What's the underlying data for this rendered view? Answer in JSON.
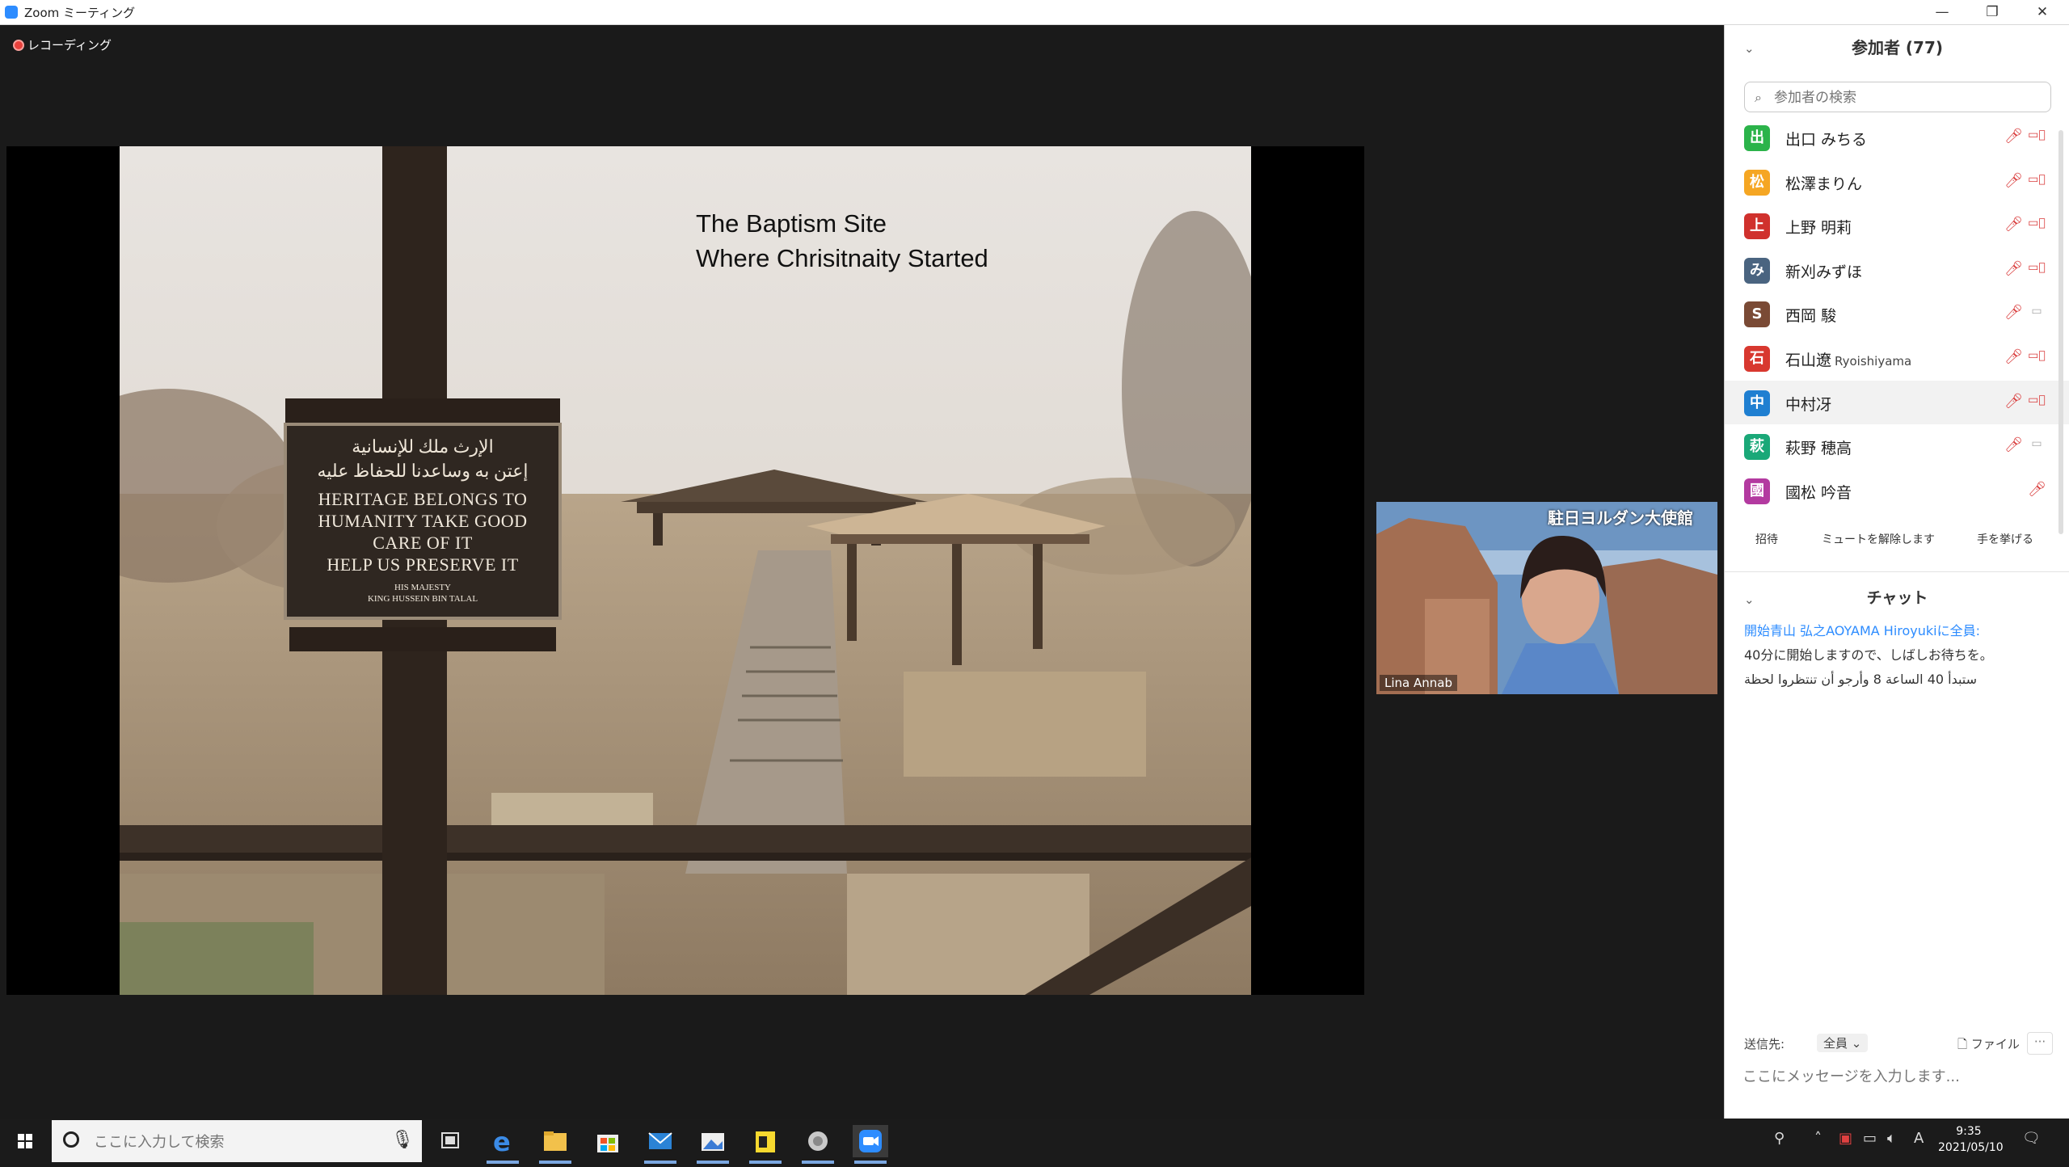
{
  "window": {
    "title": "Zoom ミーティング"
  },
  "meeting": {
    "recording_label": "レコーディング",
    "slide": {
      "title": "The Baptism Site\nWhere Chrisitnaity Started",
      "sign_arabic": "الإرث ملك للإنسانية\nإعتن به وساعدنا للحفاظ عليه",
      "sign_english": "HERITAGE BELONGS TO\nHUMANITY TAKE GOOD\nCARE OF IT\nHELP US PRESERVE IT",
      "sign_sub": "HIS MAJESTY\nKING HUSSEIN BIN TALAL"
    },
    "video": {
      "banner": "駐日ヨルダン大使館",
      "name": "Lina Annab"
    }
  },
  "participants_panel": {
    "title": "参加者 (77)",
    "search_placeholder": "参加者の検索",
    "items": [
      {
        "initial": "出",
        "name": "出口 みちる",
        "sub": "",
        "color": "#2bb34a",
        "mic_muted": true,
        "video_off": true
      },
      {
        "initial": "松",
        "name": "松澤まりん",
        "sub": "",
        "color": "#f5a623",
        "mic_muted": true,
        "video_off": true
      },
      {
        "initial": "上",
        "name": "上野 明莉",
        "sub": "",
        "color": "#d0312d",
        "mic_muted": true,
        "video_off": true
      },
      {
        "initial": "み",
        "name": "新刈みずほ",
        "sub": "",
        "color": "#4a6480",
        "mic_muted": true,
        "video_off": true
      },
      {
        "initial": "S",
        "name": "西岡 駿",
        "sub": "",
        "color": "#7a4a35",
        "mic_muted": true,
        "video_off": false
      },
      {
        "initial": "石",
        "name": "石山遼",
        "sub": "Ryoishiyama",
        "color": "#d8382f",
        "mic_muted": true,
        "video_off": true
      },
      {
        "initial": "中",
        "name": "中村冴",
        "sub": "",
        "color": "#1f7fd1",
        "mic_muted": true,
        "video_off": true
      },
      {
        "initial": "萩",
        "name": "萩野 穂高",
        "sub": "",
        "color": "#1aa878",
        "mic_muted": true,
        "video_off": false
      },
      {
        "initial": "國",
        "name": "國松 吟音",
        "sub": "",
        "color": "#b33aa0",
        "mic_muted": true,
        "video_off": null
      }
    ],
    "buttons": {
      "invite": "招待",
      "unmute_all": "ミュートを解除します",
      "raise_hand": "手を挙げる"
    }
  },
  "chat": {
    "title": "チャット",
    "messages": [
      {
        "from": "開始青山 弘之AOYAMA Hiroyukiに全員:",
        "text": "40分に開始しますので、しばしお待ちを。",
        "text2": "ستبدأ 40 الساعة 8 وأرجو أن تنتظروا لحظة"
      }
    ],
    "send_to_label": "送信先:",
    "send_to_value": "全員",
    "file_label": "ファイル",
    "more_label": "···",
    "input_placeholder": "ここにメッセージを入力します..."
  },
  "taskbar": {
    "search_placeholder": "ここに入力して検索",
    "clock_time": "9:35",
    "clock_date": "2021/05/10",
    "ime_label": "A"
  }
}
